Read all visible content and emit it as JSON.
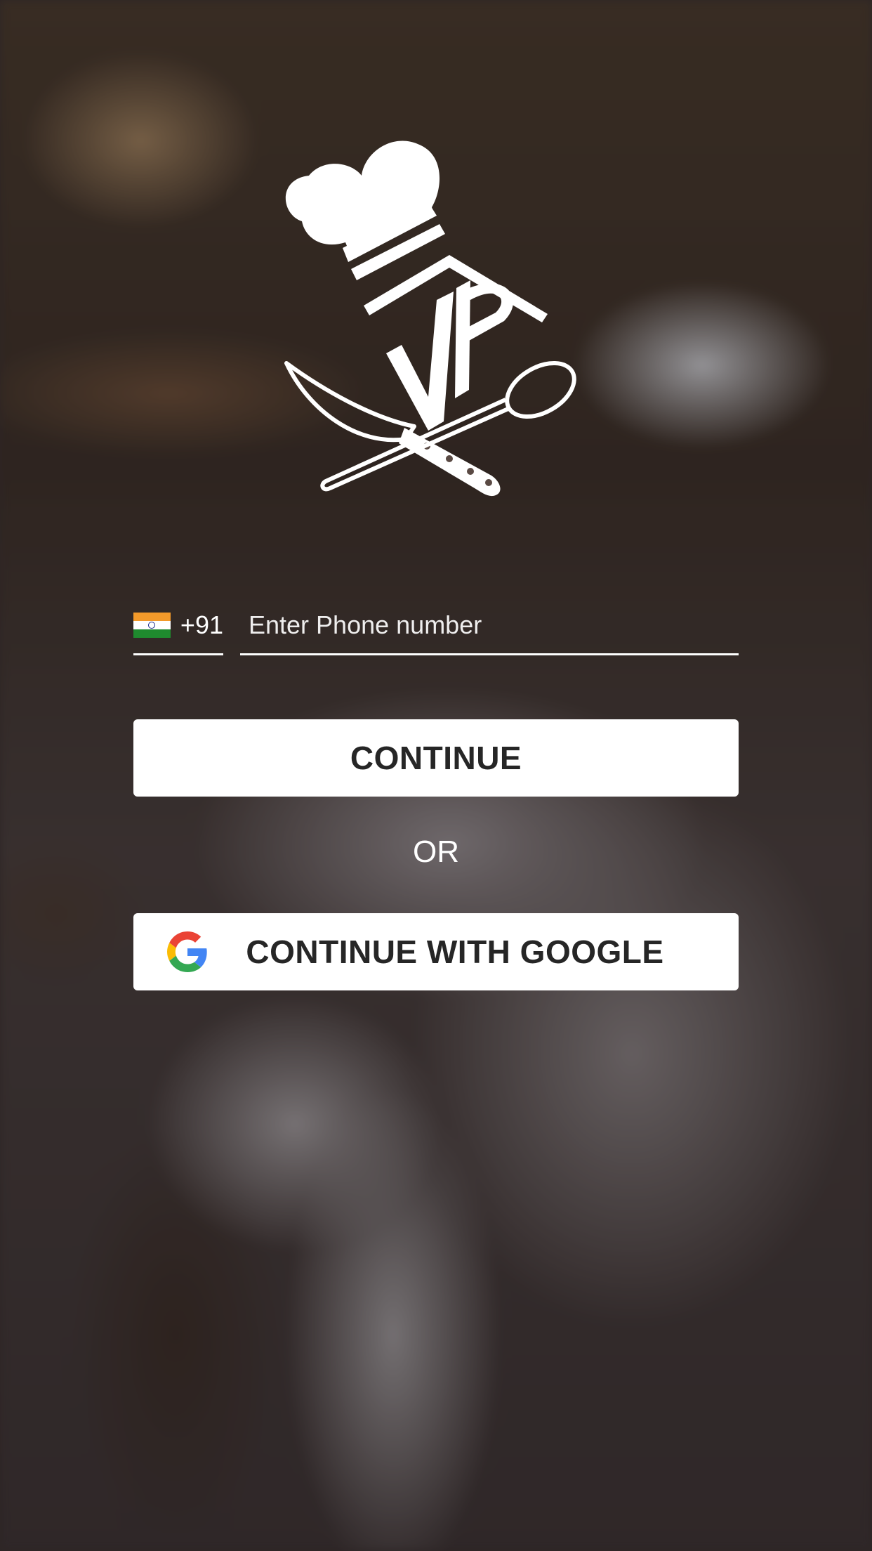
{
  "login": {
    "country_code": "+91",
    "country_flag": "india-flag",
    "phone_placeholder": "Enter Phone number",
    "phone_value": "",
    "continue_label": "CONTINUE",
    "or_label": "OR",
    "google_label": "CONTINUE WITH GOOGLE",
    "google_icon": "google-g-icon"
  },
  "brand": {
    "logo": "chef-hat-knife-spoon-logo",
    "logo_letters": "JP",
    "logo_color": "#ffffff"
  },
  "colors": {
    "button_bg": "#ffffff",
    "button_text": "#262626",
    "flag_saffron": "#f39a2a",
    "flag_green": "#1f8a2e",
    "google_blue": "#4285F4",
    "google_red": "#EA4335",
    "google_yellow": "#FBBC05",
    "google_green": "#34A853"
  }
}
